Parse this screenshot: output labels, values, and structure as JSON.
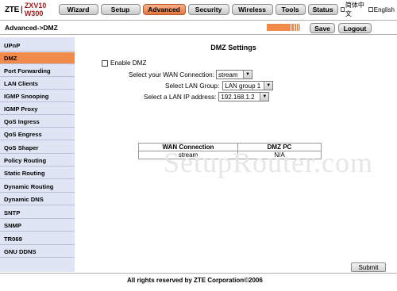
{
  "brand": {
    "name": "ZTE",
    "model": "ZXV10 W300"
  },
  "tabs": [
    {
      "label": "Wizard"
    },
    {
      "label": "Setup"
    },
    {
      "label": "Advanced"
    },
    {
      "label": "Security"
    },
    {
      "label": "Wireless"
    },
    {
      "label": "Tools"
    },
    {
      "label": "Status"
    }
  ],
  "language": {
    "chinese": "简体中文",
    "english": "English"
  },
  "breadcrumb": "Advanced->DMZ",
  "toolbar": {
    "save_label": "Save",
    "logout_label": "Logout"
  },
  "sidebar": {
    "items": [
      {
        "label": "UPnP"
      },
      {
        "label": "DMZ",
        "active": true
      },
      {
        "label": "Port Forwarding"
      },
      {
        "label": "LAN Clients"
      },
      {
        "label": "IGMP Snooping"
      },
      {
        "label": "IGMP Proxy"
      },
      {
        "label": "QoS Ingress"
      },
      {
        "label": "QoS Engress"
      },
      {
        "label": "QoS Shaper"
      },
      {
        "label": "Policy Routing"
      },
      {
        "label": "Static Routing"
      },
      {
        "label": "Dynamic Routing"
      },
      {
        "label": "Dynamic DNS"
      },
      {
        "label": "SNTP"
      },
      {
        "label": "SNMP"
      },
      {
        "label": "TR069"
      },
      {
        "label": "GNU DDNS"
      }
    ]
  },
  "dmz": {
    "title": "DMZ Settings",
    "enable_label": "Enable DMZ",
    "enable_checked": false,
    "wan_label": "Select your WAN Connection:",
    "wan_value": "stream",
    "lan_group_label": "Select LAN Group:",
    "lan_group_value": "LAN group 1",
    "lan_ip_label": "Select a LAN IP address:",
    "lan_ip_value": "192.168.1.2",
    "table": {
      "headers": [
        "WAN Connection",
        "DMZ PC"
      ],
      "rows": [
        [
          "stream",
          "N/A"
        ]
      ]
    }
  },
  "watermark": "SetupRouter.com",
  "submit_label": "Submit",
  "footer": "All rights reserved by ZTE Corporation©2006",
  "colors": {
    "accent": "#f08b4c",
    "sidebar_bg": "#dfe5f4"
  }
}
